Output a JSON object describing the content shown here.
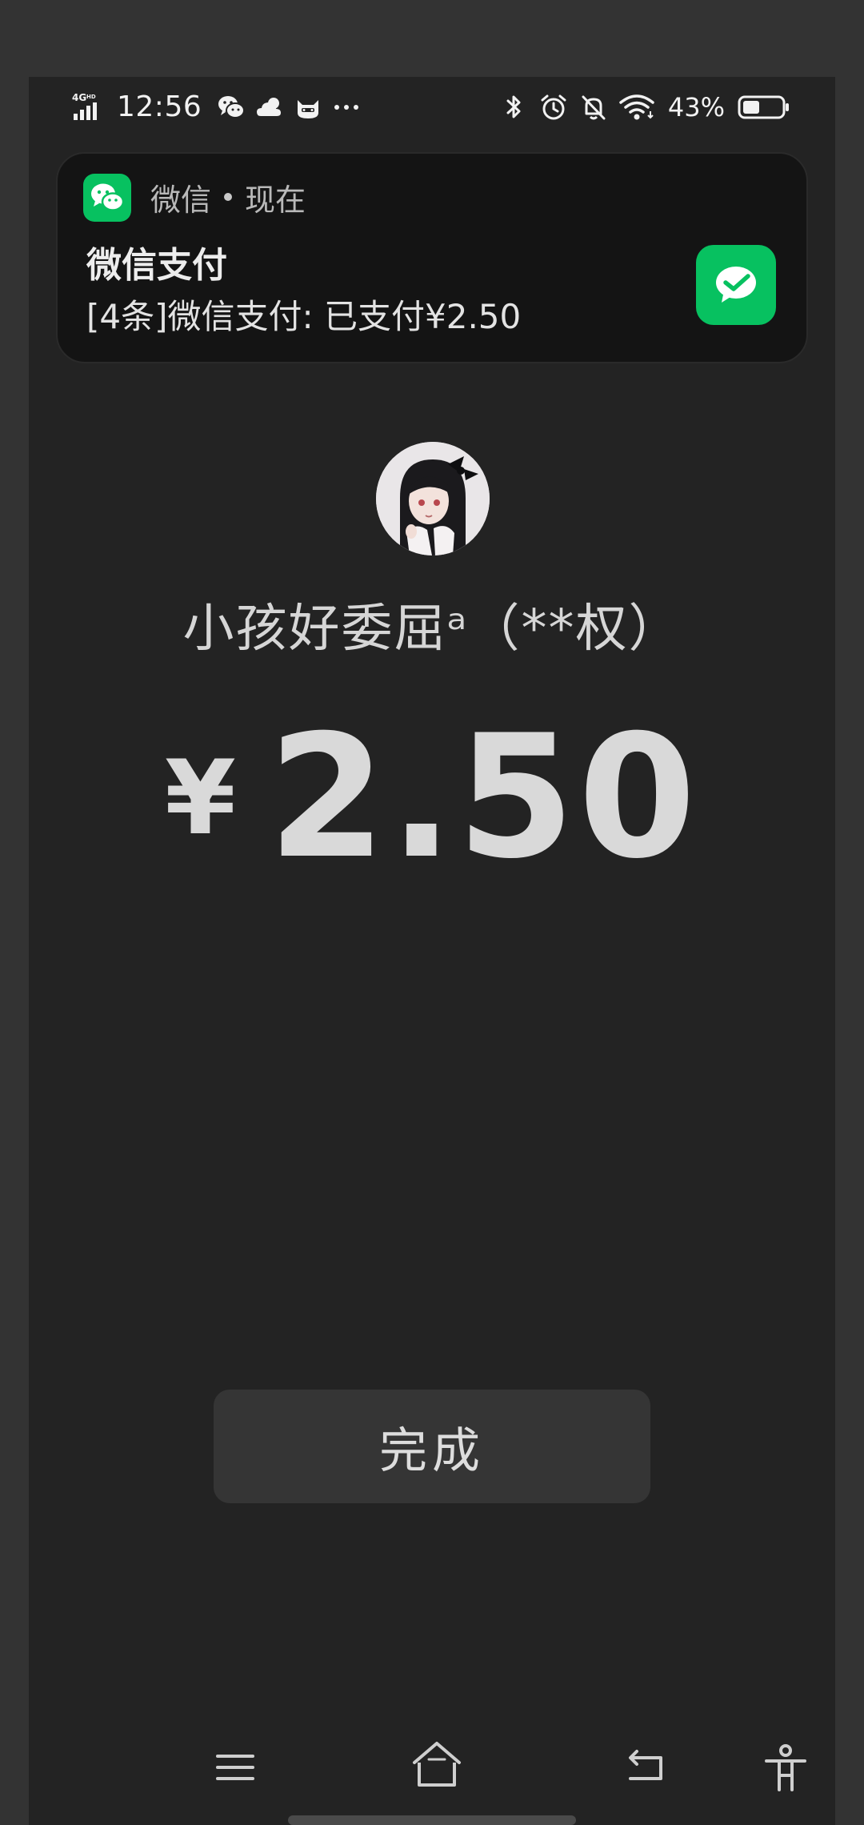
{
  "status_bar": {
    "network": "4GHD",
    "time": "12:56",
    "battery": "43%",
    "left_icons": [
      "wechat-icon",
      "weather-cloud-icon",
      "cat-face-icon",
      "more-dots-icon"
    ],
    "right_icons": [
      "bluetooth-icon",
      "alarm-icon",
      "bell-off-icon",
      "wifi-icon",
      "battery-icon"
    ]
  },
  "notification": {
    "app_name": "微信",
    "time": "现在",
    "title": "微信支付",
    "body": "[4条]微信支付: 已支付¥2.50",
    "accent_color": "#07c160"
  },
  "payment": {
    "payee": "小孩好委屈ᵃ（**权）",
    "currency": "¥",
    "amount": "2.50"
  },
  "actions": {
    "done_label": "完成"
  },
  "nav": {
    "items": [
      "menu-icon",
      "home-icon",
      "back-icon",
      "accessibility-icon"
    ]
  },
  "colors": {
    "background": "#232323",
    "outer": "#333333",
    "wechat_green": "#07c160",
    "button_bg": "#353535"
  }
}
